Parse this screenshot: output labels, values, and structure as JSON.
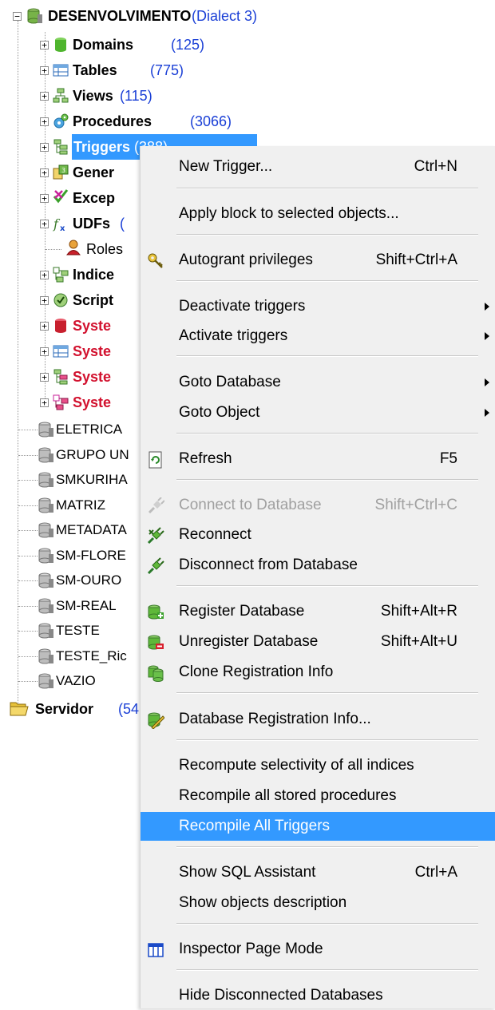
{
  "tree": {
    "root": {
      "name": "DESENVOLVIMENTO",
      "dialect": "(Dialect 3)"
    },
    "children": [
      {
        "name": "Domains",
        "count": "(125)",
        "icon": "domain-icon"
      },
      {
        "name": "Tables",
        "count": "(775)",
        "icon": "table-icon"
      },
      {
        "name": "Views",
        "count": "(115)",
        "icon": "view-icon"
      },
      {
        "name": "Procedures",
        "count": "(3066)",
        "icon": "procedure-icon"
      },
      {
        "name": "Triggers",
        "count": "(388)",
        "icon": "trigger-icon",
        "selected": true
      },
      {
        "name": "Gener",
        "count": "",
        "icon": "generator-icon"
      },
      {
        "name": "Excep",
        "count": "",
        "icon": "exception-icon"
      },
      {
        "name": "UDFs",
        "count": "(",
        "icon": "udf-icon"
      },
      {
        "name": "Roles",
        "count": "",
        "icon": "roles-icon"
      },
      {
        "name": "Indice",
        "count": "",
        "icon": "index-icon"
      },
      {
        "name": "Script",
        "count": "",
        "icon": "script-icon"
      },
      {
        "name": "Syste",
        "count": "",
        "icon": "system-domain-icon",
        "system": true
      },
      {
        "name": "Syste",
        "count": "",
        "icon": "system-table-icon",
        "system": true
      },
      {
        "name": "Syste",
        "count": "",
        "icon": "system-trigger-icon",
        "system": true
      },
      {
        "name": "Syste",
        "count": "",
        "icon": "system-index-icon",
        "system": true
      }
    ],
    "databases": [
      "ELETRICA",
      "GRUPO UN",
      "SMKURIHA",
      "MATRIZ",
      "METADATA",
      "SM-FLORE",
      "SM-OURO",
      "SM-REAL",
      "TESTE",
      "TESTE_Ric",
      "VAZIO"
    ],
    "server": {
      "name": "Servidor",
      "count": "(54"
    }
  },
  "menu": {
    "items": [
      {
        "label": "New Trigger...",
        "shortcut": "Ctrl+N"
      },
      {
        "label": "Apply block to selected objects..."
      },
      {
        "label": "Autogrant privileges",
        "shortcut": "Shift+Ctrl+A"
      },
      {
        "label": "Deactivate triggers"
      },
      {
        "label": "Activate triggers"
      },
      {
        "label": "Goto Database"
      },
      {
        "label": "Goto Object"
      },
      {
        "label": "Refresh",
        "shortcut": "F5"
      },
      {
        "label": "Connect to Database",
        "shortcut": "Shift+Ctrl+C"
      },
      {
        "label": "Reconnect"
      },
      {
        "label": "Disconnect from Database"
      },
      {
        "label": "Register Database",
        "shortcut": "Shift+Alt+R"
      },
      {
        "label": "Unregister Database",
        "shortcut": "Shift+Alt+U"
      },
      {
        "label": "Clone Registration Info"
      },
      {
        "label": "Database Registration Info..."
      },
      {
        "label": "Recompute selectivity of all indices"
      },
      {
        "label": "Recompile all stored procedures"
      },
      {
        "label": "Recompile All Triggers"
      },
      {
        "label": "Show SQL Assistant",
        "shortcut": "Ctrl+A"
      },
      {
        "label": "Show objects description"
      },
      {
        "label": "Inspector Page Mode"
      },
      {
        "label": "Hide Disconnected Databases"
      }
    ]
  },
  "colors": {
    "selection": "#3399ff",
    "count_blue": "#1a3fd6",
    "system_red": "#d2112e",
    "menu_bg": "#f0f0f0"
  }
}
